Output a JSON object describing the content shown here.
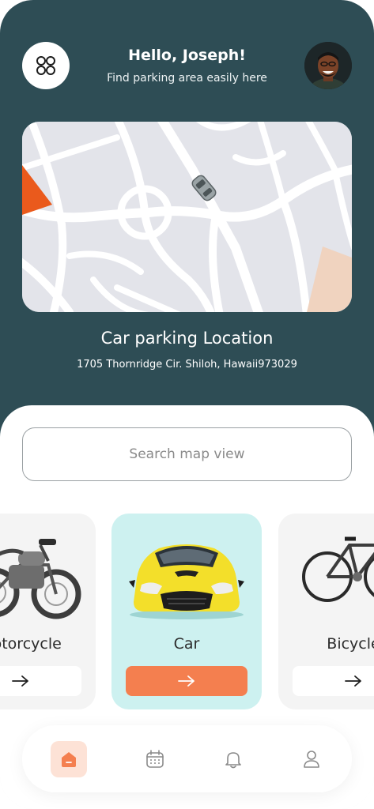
{
  "header": {
    "greeting": "Hello, Joseph!",
    "subtitle": "Find parking area easily here"
  },
  "icons": {
    "menu": "grid-four-circles-icon",
    "avatar": "user-avatar-photo",
    "car_marker": "car-marker-icon",
    "arrow": "arrow-right-icon",
    "home": "home-icon",
    "calendar": "calendar-icon",
    "bell": "bell-icon",
    "profile": "user-icon"
  },
  "location": {
    "title": "Car parking Location",
    "address": "1705 Thornridge Cir. Shiloh, Hawaii973029"
  },
  "search": {
    "placeholder": "Search map view"
  },
  "vehicles": [
    {
      "label": "Motorcycle",
      "selected": false
    },
    {
      "label": "Car",
      "selected": true
    },
    {
      "label": "Bicycle",
      "selected": false
    }
  ],
  "nav": {
    "items": [
      "home",
      "calendar",
      "notifications",
      "profile"
    ],
    "active": "home"
  },
  "colors": {
    "header_bg": "#2e4d55",
    "accent": "#f47f4f",
    "selected_card": "#cdf1f0",
    "map_bg": "#e3e4ea",
    "map_orange": "#ea5a1c",
    "map_peach": "#f0d3bf"
  }
}
